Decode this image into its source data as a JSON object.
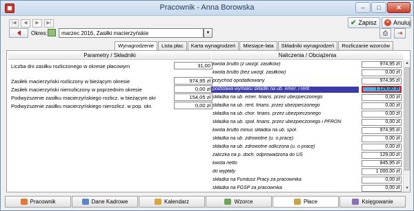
{
  "window": {
    "title": "Pracownik - Anna Borowska"
  },
  "toolbar": {
    "nav": [
      "|◀",
      "◀",
      "▶",
      "▶|"
    ],
    "save_label": "Zapisz",
    "cancel_label": "Anuluj",
    "okres_label": "Okres:",
    "okres_value": "marzec 2016, Zasiłki macierzyńskie"
  },
  "tabs": [
    "Wynagrodzenie",
    "Lista płac",
    "Karta wynagrodzeń",
    "Miesiące-lata",
    "Składniki wynagrodzeń",
    "Rozliczanie wzorców"
  ],
  "left": {
    "header": "Parametry / Składniki",
    "rows": [
      {
        "label": "Liczba dni zasiłku rozliczonego w okresie płacowym",
        "value": "31,00"
      },
      {
        "label": "Zasiłek macierzyński rozliczony w bieżącym okresie",
        "value": "974,95 zł"
      },
      {
        "label": "Zasiłek macierzyński nierozliczony w poprzednim okresie",
        "value": "0,00 zł"
      },
      {
        "label": "Podwyższenie zasiłku macierzyńskiego rozlicz. w bieżącym okr",
        "value": "154,05 zł"
      },
      {
        "label": "Podwyższenie zasiłku macierzyńskiego nierozlicz. w pop. okr.",
        "value": "0,00 zł"
      }
    ]
  },
  "right": {
    "header": "Naliczenia / Obciążenia",
    "rows": [
      {
        "label": "kwota brutto (z uwzgl. zasiłków)",
        "value": "974,95 zł"
      },
      {
        "label": "kwota brutto (bez uwzgl. zasiłków)",
        "value": "0,00 zł"
      },
      {
        "label": "przychód opodatkowany",
        "value": "974,95 zł"
      },
      {
        "label": "podstawa wymiaru składki na ub. emer. i rent.",
        "value": "1 129,00 zł"
      },
      {
        "label": "składka na ub. emer. finans. przez ubezpieczonego",
        "value": "0,00 zł"
      },
      {
        "label": "składka na ub. rent. finans. przez ubezpieczonego",
        "value": "0,00 zł"
      },
      {
        "label": "składka na ub. chor. finans. przez ubezpieczonego",
        "value": "0,00 zł"
      },
      {
        "label": "składka na ub. społ. finans. przez ubezpieczonego i PFRON",
        "value": "0,00 zł"
      },
      {
        "label": "kwota brutto minus składka na ub. społ.",
        "value": "974,95 zł"
      },
      {
        "label": "składka na ub. zdrowotne (u. o pracę)",
        "value": "0,00 zł"
      },
      {
        "label": "składka na ub. zdrowotne odliczona (u. o pracę)",
        "value": "0,00 zł"
      },
      {
        "label": "zaliczka na p. doch. odprowadzona do US",
        "value": "129,00 zł"
      },
      {
        "label": "kwota netto",
        "value": "845,95 zł"
      },
      {
        "label": "do wypłaty",
        "value": "1 000,00 zł"
      },
      {
        "label": "składka na Fundusz Pracy za pracownika",
        "value": "0,00 zł"
      },
      {
        "label": "składka na FGŚP za pracownika",
        "value": "0,00 zł"
      }
    ]
  },
  "bottom_tabs": [
    "Pracownik",
    "Dane Kadrowe",
    "Kalendarz",
    "Wzorce",
    "Płace",
    "Księgowanie"
  ],
  "colors": {
    "selection": "#3a3aa8",
    "selected_value": "#4aaee8",
    "highlight_border": "#d61d1d"
  }
}
